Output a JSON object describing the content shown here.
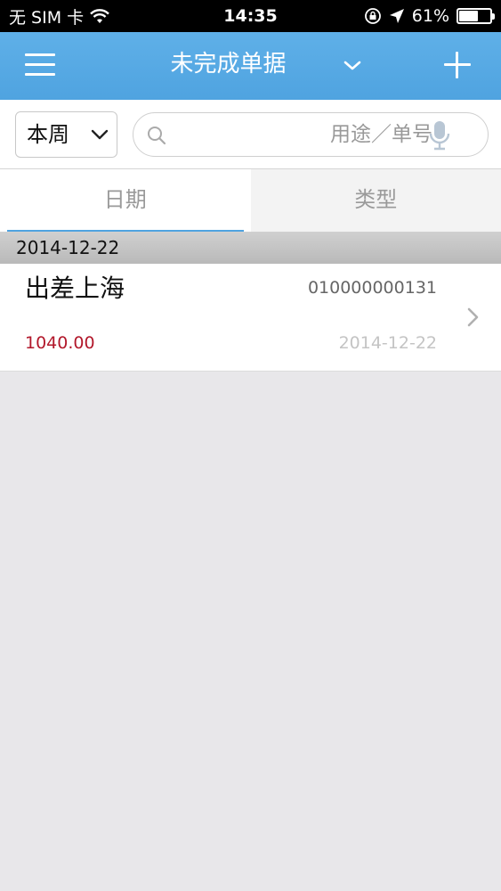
{
  "status_bar": {
    "carrier": "无 SIM 卡",
    "time": "14:35",
    "battery_percent": "61%",
    "battery_level": 0.61,
    "icons": [
      "wifi-icon",
      "rotation-lock-icon",
      "location-icon",
      "battery-icon"
    ]
  },
  "nav": {
    "title": "未完成单据",
    "icons": [
      "menu-icon",
      "chevron-down-icon",
      "plus-icon"
    ],
    "accent": "#4fa3e0"
  },
  "filter": {
    "period_selected": "本周",
    "search_placeholder": "用途／单号",
    "search_value": ""
  },
  "tabs": [
    {
      "label": "日期",
      "active": true
    },
    {
      "label": "类型",
      "active": false
    }
  ],
  "groups": [
    {
      "date_header": "2014-12-22",
      "records": [
        {
          "purpose": "出差上海",
          "number": "010000000131",
          "amount": "1040.00",
          "date": "2014-12-22"
        }
      ]
    }
  ],
  "colors": {
    "amount": "#b2182b",
    "background": "#e8e7ea",
    "nav_bar": "#4fa3e0"
  }
}
